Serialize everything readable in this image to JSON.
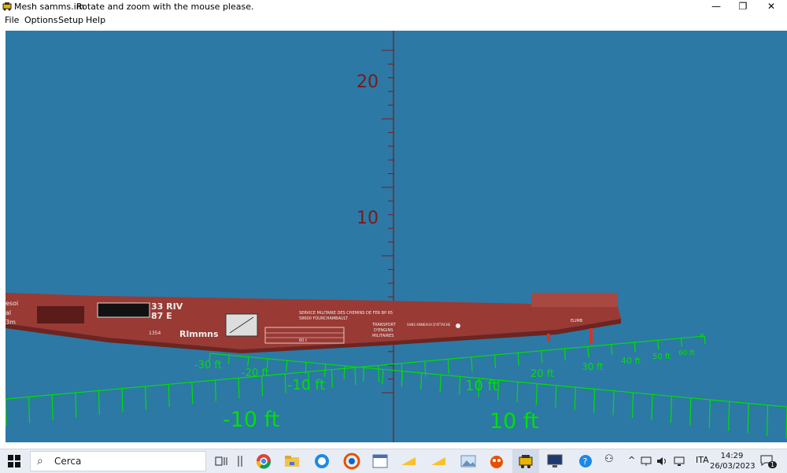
{
  "window": {
    "title": "Mesh samms.im",
    "hint": "Rotate and zoom with the mouse please.",
    "minimize": "—",
    "restore": "❐",
    "close": "✕"
  },
  "menu": [
    "File",
    "Options",
    "Setup",
    "Help"
  ],
  "viewport": {
    "background": "#2c79a5",
    "vertical_axis": {
      "ticks": [
        "20",
        "10"
      ]
    },
    "ground_axis_labels": {
      "far": [
        "-30 ft",
        "-20 ft",
        "20 ft",
        "30 ft",
        "40 ft",
        "50 ft",
        "60 ft",
        "Y"
      ],
      "mid": [
        "-10 ft",
        "10 ft"
      ],
      "near": [
        "-10 ft",
        "10 ft"
      ]
    },
    "wagon": {
      "class": "Rlmmns",
      "code_lines": [
        "33 RIV",
        "87 E"
      ],
      "operator": [
        "SERVICE MILITAIRE DES CHEMINS DE FER BP 65",
        "58600 FOURCHAMBAULT"
      ],
      "transport": [
        "TRANSPORT",
        "D'ENGINS",
        "MILITAIRES"
      ],
      "left_edge": [
        "esoi",
        "al",
        "3m"
      ],
      "small": "1354",
      "table": "60 t",
      "attache": "SANS ANNEAUX D'ATTACHE",
      "right_mark": "ELIMB"
    }
  },
  "taskbar": {
    "search_placeholder": "Cerca",
    "language": "ITA",
    "time": "14:29",
    "date": "26/03/2023",
    "notifications": "1"
  },
  "colors": {
    "grid_green": "#00e000",
    "vertical_axis": "#7a1a1a",
    "wagon_body": "#9a3a34"
  }
}
